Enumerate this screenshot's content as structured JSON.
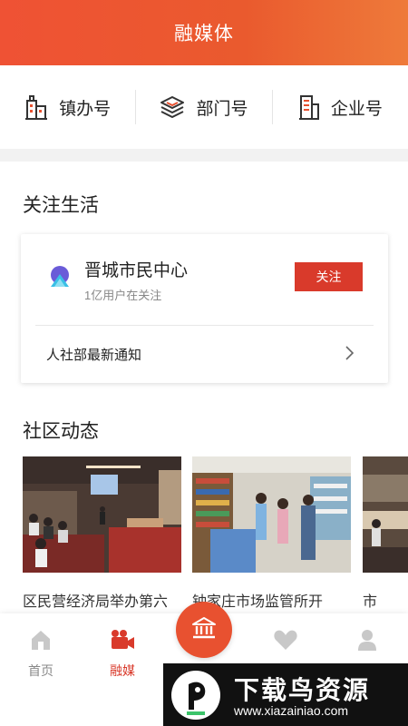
{
  "header": {
    "title": "融媒体"
  },
  "quick": [
    {
      "label": "镇办号",
      "icon": "building-icon"
    },
    {
      "label": "部门号",
      "icon": "layers-icon"
    },
    {
      "label": "企业号",
      "icon": "office-icon"
    }
  ],
  "follow_section": {
    "title": "关注生活",
    "account": {
      "name": "晋城市民中心",
      "followers": "1亿用户在关注",
      "follow_label": "关注"
    },
    "notice": "人社部最新通知"
  },
  "community": {
    "title": "社区动态",
    "items": [
      {
        "caption": "区民营经济局举办第六"
      },
      {
        "caption": "钟家庄市场监管所开"
      },
      {
        "caption": "市"
      }
    ]
  },
  "tabbar": {
    "tabs": [
      {
        "label": "首页",
        "icon": "home-icon"
      },
      {
        "label": "融媒",
        "icon": "video-camera-icon"
      },
      {
        "label": "",
        "icon": "bank-icon"
      },
      {
        "label": "",
        "icon": "heart-icon"
      },
      {
        "label": "",
        "icon": "user-icon"
      }
    ],
    "active": "融媒"
  },
  "watermark": {
    "text": "下载鸟资源",
    "url": "www.xiazainiao.com"
  },
  "colors": {
    "brand": "#e85130",
    "accent_red": "#d93a2b"
  }
}
